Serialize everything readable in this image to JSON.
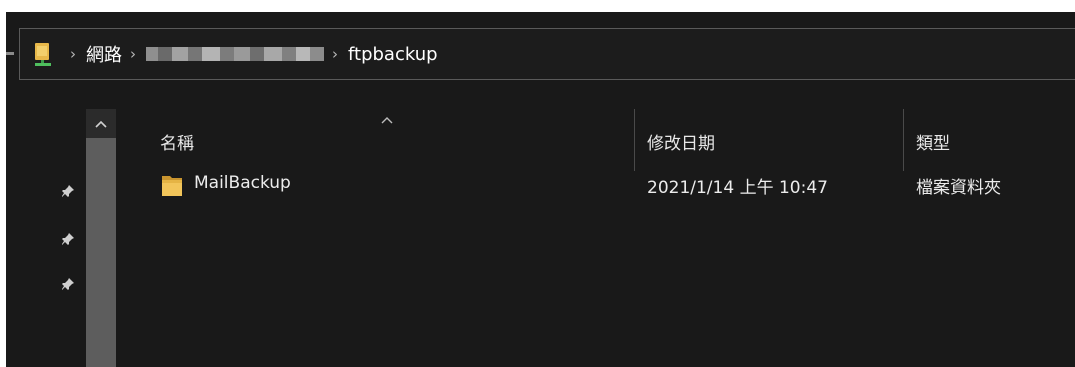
{
  "breadcrumb": {
    "segments": [
      "網路",
      "ftpbackup"
    ],
    "separator": "›"
  },
  "columns": {
    "name": "名稱",
    "modified": "修改日期",
    "type": "類型"
  },
  "files": [
    {
      "name": "MailBackup",
      "modified": "2021/1/14 上午 10:47",
      "type": "檔案資料夾"
    }
  ],
  "icons": {
    "location": "network-drive-icon",
    "folder": "folder-icon",
    "pin": "pin-icon",
    "sort": "sort-ascending-icon",
    "scroll_up": "scroll-up-icon"
  },
  "colors": {
    "background": "#191919",
    "folder": "#e8b84a",
    "text": "#ececec"
  }
}
